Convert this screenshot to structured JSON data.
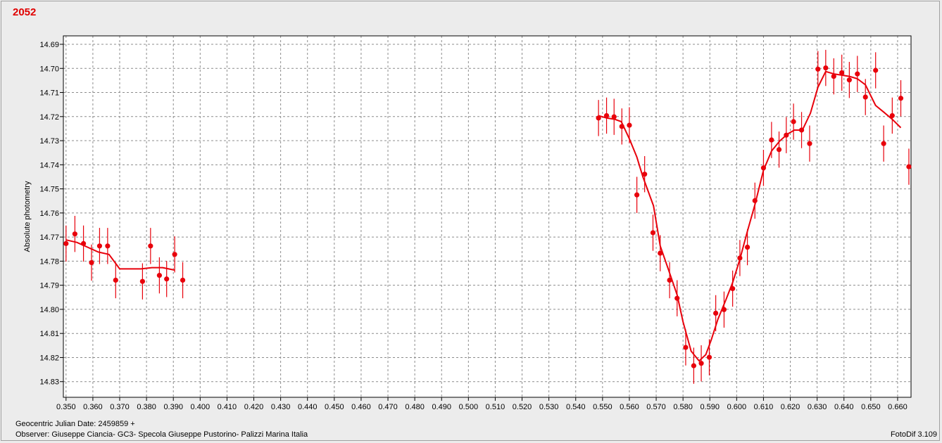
{
  "chart_data": {
    "type": "scatter",
    "title": "2052",
    "xlabel": "",
    "ylabel": "Absolute photometry",
    "xlim": [
      0.349,
      0.665
    ],
    "ylim": [
      14.6865,
      14.8365
    ],
    "y_inverted": true,
    "grid": true,
    "x_ticks": [
      0.35,
      0.36,
      0.37,
      0.38,
      0.39,
      0.4,
      0.41,
      0.42,
      0.43,
      0.44,
      0.45,
      0.46,
      0.47,
      0.48,
      0.49,
      0.5,
      0.51,
      0.52,
      0.53,
      0.54,
      0.55,
      0.56,
      0.57,
      0.58,
      0.59,
      0.6,
      0.61,
      0.62,
      0.63,
      0.64,
      0.65,
      0.66
    ],
    "x_tick_labels": [
      "0.350",
      "0.360",
      "0.370",
      "0.380",
      "0.390",
      "0.400",
      "0.410",
      "0.420",
      "0.430",
      "0.440",
      "0.450",
      "0.460",
      "0.470",
      "0.480",
      "0.490",
      "0.500",
      "0.510",
      "0.520",
      "0.530",
      "0.540",
      "0.550",
      "0.560",
      "0.570",
      "0.580",
      "0.590",
      "0.600",
      "0.610",
      "0.620",
      "0.630",
      "0.640",
      "0.650",
      "0.660"
    ],
    "y_ticks": [
      14.69,
      14.7,
      14.71,
      14.72,
      14.73,
      14.74,
      14.75,
      14.76,
      14.77,
      14.78,
      14.79,
      14.8,
      14.81,
      14.82,
      14.83
    ],
    "y_tick_labels": [
      "14.69",
      "14.70",
      "14.71",
      "14.72",
      "14.73",
      "14.74",
      "14.75",
      "14.76",
      "14.77",
      "14.78",
      "14.79",
      "14.80",
      "14.81",
      "14.82",
      "14.83"
    ],
    "color": "#e8000b",
    "series": [
      {
        "kind": "points_with_errorbars",
        "error": 0.0075,
        "points": [
          [
            0.35,
            14.7727
          ],
          [
            0.3533,
            14.7687
          ],
          [
            0.3565,
            14.7727
          ],
          [
            0.3595,
            14.7806
          ],
          [
            0.3625,
            14.7737
          ],
          [
            0.3655,
            14.7737
          ],
          [
            0.3685,
            14.7879
          ],
          [
            0.3785,
            14.7884
          ],
          [
            0.3815,
            14.7737
          ],
          [
            0.3848,
            14.7859
          ],
          [
            0.3875,
            14.7874
          ],
          [
            0.3905,
            14.7772
          ],
          [
            0.3935,
            14.7879
          ],
          [
            0.5485,
            14.7206
          ],
          [
            0.5515,
            14.7196
          ],
          [
            0.5543,
            14.7201
          ],
          [
            0.5572,
            14.7241
          ],
          [
            0.56,
            14.7236
          ],
          [
            0.5628,
            14.7525
          ],
          [
            0.5657,
            14.7439
          ],
          [
            0.5688,
            14.7682
          ],
          [
            0.5715,
            14.7767
          ],
          [
            0.575,
            14.7879
          ],
          [
            0.5778,
            14.7954
          ],
          [
            0.581,
            14.8158
          ],
          [
            0.584,
            14.8234
          ],
          [
            0.5868,
            14.8224
          ],
          [
            0.5898,
            14.8199
          ],
          [
            0.5922,
            14.8016
          ],
          [
            0.5953,
            14.8001
          ],
          [
            0.5985,
            14.7914
          ],
          [
            0.6012,
            14.7787
          ],
          [
            0.604,
            14.7742
          ],
          [
            0.6068,
            14.7549
          ],
          [
            0.61,
            14.7413
          ],
          [
            0.613,
            14.7297
          ],
          [
            0.6158,
            14.7337
          ],
          [
            0.6185,
            14.7277
          ],
          [
            0.6212,
            14.7221
          ],
          [
            0.6242,
            14.7256
          ],
          [
            0.6272,
            14.7312
          ],
          [
            0.6303,
            14.7003
          ],
          [
            0.6332,
            14.6998
          ],
          [
            0.6362,
            14.7033
          ],
          [
            0.6392,
            14.7018
          ],
          [
            0.642,
            14.7048
          ],
          [
            0.645,
            14.7023
          ],
          [
            0.648,
            14.7119
          ],
          [
            0.6518,
            14.7008
          ],
          [
            0.6548,
            14.7312
          ],
          [
            0.658,
            14.7196
          ],
          [
            0.6612,
            14.7124
          ],
          [
            0.6642,
            14.7408
          ]
        ]
      },
      {
        "kind": "fit_line",
        "segments": [
          [
            [
              0.35,
              14.7712
            ],
            [
              0.354,
              14.7722
            ],
            [
              0.358,
              14.7742
            ],
            [
              0.362,
              14.7762
            ],
            [
              0.366,
              14.7772
            ],
            [
              0.37,
              14.7832
            ],
            [
              0.374,
              14.7832
            ],
            [
              0.378,
              14.7832
            ],
            [
              0.382,
              14.7827
            ],
            [
              0.386,
              14.7827
            ],
            [
              0.3905,
              14.7837
            ]
          ],
          [
            [
              0.5485,
              14.7196
            ],
            [
              0.5515,
              14.7206
            ],
            [
              0.5545,
              14.7211
            ],
            [
              0.557,
              14.7221
            ],
            [
              0.56,
              14.7292
            ],
            [
              0.5628,
              14.7368
            ],
            [
              0.565,
              14.7449
            ],
            [
              0.569,
              14.757
            ],
            [
              0.5715,
              14.7737
            ],
            [
              0.5745,
              14.7833
            ],
            [
              0.5778,
              14.794
            ],
            [
              0.58,
              14.8051
            ],
            [
              0.583,
              14.8173
            ],
            [
              0.586,
              14.8214
            ],
            [
              0.5885,
              14.8188
            ],
            [
              0.5905,
              14.8128
            ],
            [
              0.593,
              14.8041
            ],
            [
              0.596,
              14.796
            ],
            [
              0.5985,
              14.7889
            ],
            [
              0.6012,
              14.7792
            ],
            [
              0.604,
              14.7676
            ],
            [
              0.6068,
              14.7565
            ],
            [
              0.61,
              14.7423
            ],
            [
              0.613,
              14.7343
            ],
            [
              0.616,
              14.7302
            ],
            [
              0.619,
              14.7272
            ],
            [
              0.6215,
              14.7256
            ],
            [
              0.6245,
              14.7256
            ],
            [
              0.6275,
              14.7186
            ],
            [
              0.6303,
              14.7078
            ],
            [
              0.6332,
              14.7013
            ],
            [
              0.6362,
              14.7023
            ],
            [
              0.6392,
              14.7028
            ],
            [
              0.642,
              14.7033
            ],
            [
              0.645,
              14.7043
            ],
            [
              0.648,
              14.7068
            ],
            [
              0.6518,
              14.7154
            ],
            [
              0.6548,
              14.7181
            ],
            [
              0.658,
              14.7211
            ],
            [
              0.6612,
              14.7246
            ]
          ]
        ]
      }
    ]
  },
  "footer": {
    "julian_date": "Geocentric Julian Date: 2459859 +",
    "observer": "Observer: Giuseppe Ciancia- GC3- Specola Giuseppe Pustorino- Palizzi Marina Italia",
    "software": "FotoDif 3.109"
  }
}
